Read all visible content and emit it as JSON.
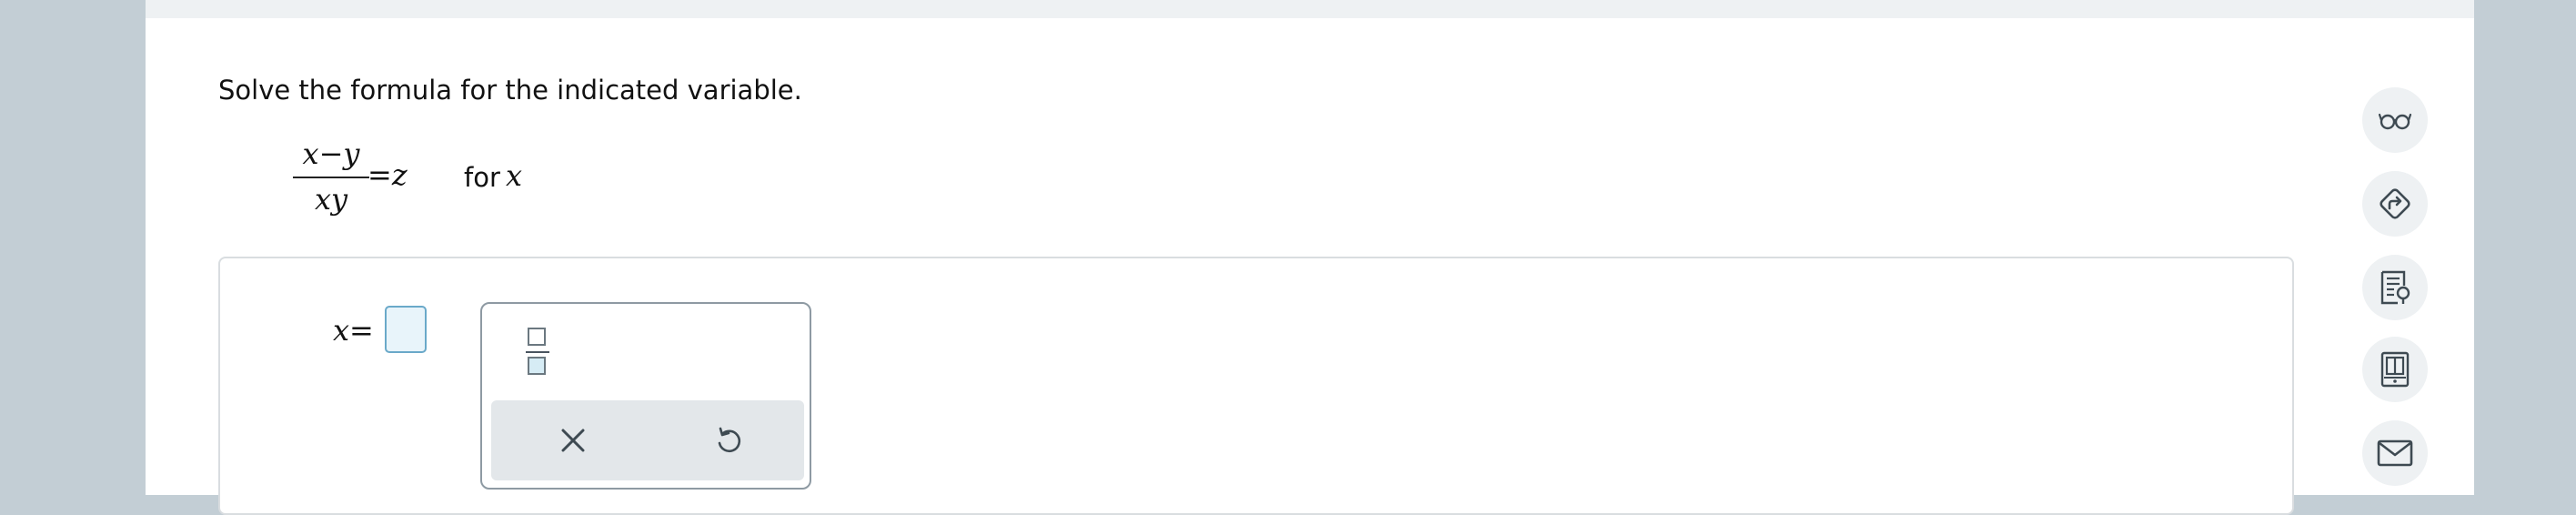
{
  "question": {
    "instruction": "Solve the formula for the indicated variable.",
    "formula": {
      "numerator": "x−y",
      "denominator": "xy",
      "rhs": "=z"
    },
    "for_label": "for",
    "for_variable": "x"
  },
  "answer": {
    "lhs": "x=",
    "value": ""
  },
  "math_palette": {
    "tools": [
      "fraction-tool"
    ],
    "actions": [
      "clear-icon",
      "undo-icon"
    ]
  },
  "sidebar": {
    "icons": [
      "glasses-icon",
      "directions-icon",
      "textbook-icon",
      "ebook-icon",
      "mail-icon"
    ]
  },
  "colors": {
    "answer_box_border": "#6aa9c9",
    "answer_box_fill": "#e8f4fa",
    "panel_bg": "#e3e7ea"
  }
}
